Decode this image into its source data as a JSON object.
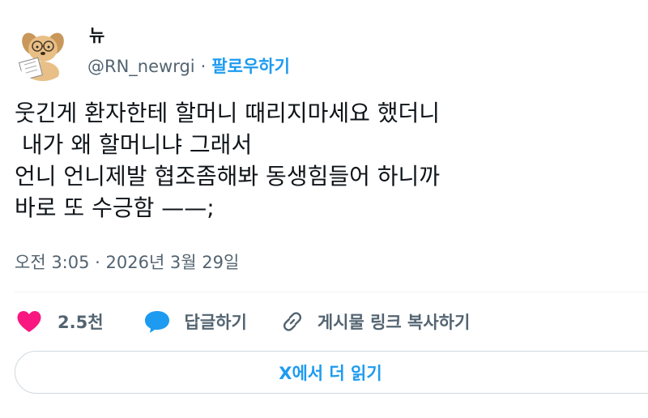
{
  "author": {
    "display_name": "뉴",
    "handle": "@RN_newrgi",
    "separator": "·",
    "follow_label": "팔로우하기"
  },
  "tweet": {
    "lines": [
      "웃긴게 환자한테 할머니 때리지마세요 했더니",
      " 내가 왜 할머니냐 그래서",
      "언니 언니제발 협조좀해봐 동생힘들어 하니까",
      "바로 또 수긍함 ——;"
    ],
    "timestamp": "오전 3:05 · 2026년 3월 29일"
  },
  "actions": {
    "like_count": "2.5천",
    "reply_label": "답글하기",
    "copy_link_label": "게시물 링크 복사하기"
  },
  "read_more_label": "X에서 더 읽기",
  "colors": {
    "accent": "#1d9bf0",
    "like": "#f91880",
    "secondary_text": "#536471",
    "primary_text": "#0f1419"
  },
  "icons": {
    "avatar": "dog-reading-paper-avatar",
    "like": "heart-icon",
    "reply": "speech-bubble-icon",
    "copy_link": "link-icon"
  }
}
